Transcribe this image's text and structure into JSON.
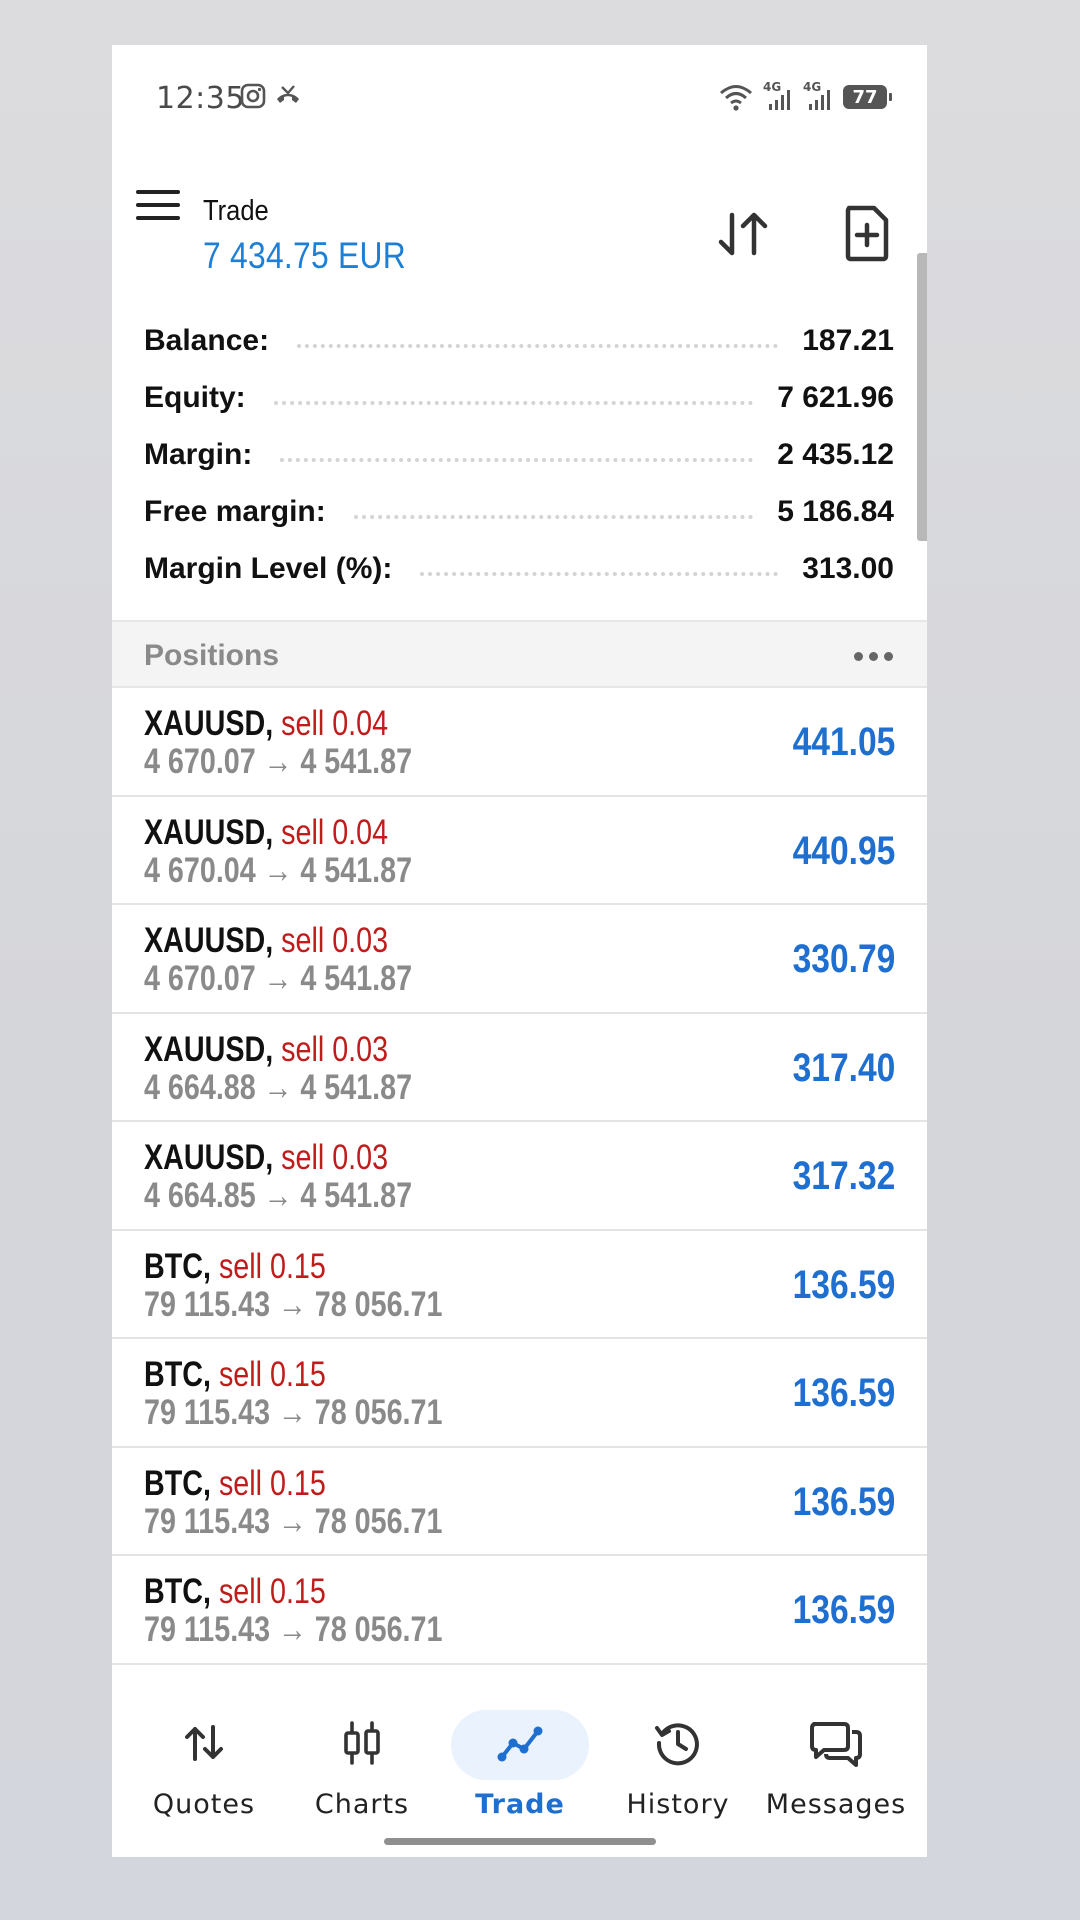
{
  "status_bar": {
    "time": "12:35",
    "net1": "4G",
    "net2": "4G",
    "battery": "77"
  },
  "header": {
    "title": "Trade",
    "subtitle": "7 434.75 EUR"
  },
  "summary": [
    {
      "label": "Balance:",
      "value": "187.21"
    },
    {
      "label": "Equity:",
      "value": "7 621.96"
    },
    {
      "label": "Margin:",
      "value": "2 435.12"
    },
    {
      "label": "Free margin:",
      "value": "5 186.84"
    },
    {
      "label": "Margin Level (%):",
      "value": "313.00"
    }
  ],
  "positions": {
    "label": "Positions",
    "items": [
      {
        "symbol": "XAUUSD,",
        "side": "sell 0.04",
        "prices": "4 670.07 → 4 541.87",
        "profit": "441.05"
      },
      {
        "symbol": "XAUUSD,",
        "side": "sell 0.04",
        "prices": "4 670.04 → 4 541.87",
        "profit": "440.95"
      },
      {
        "symbol": "XAUUSD,",
        "side": "sell 0.03",
        "prices": "4 670.07 → 4 541.87",
        "profit": "330.79"
      },
      {
        "symbol": "XAUUSD,",
        "side": "sell 0.03",
        "prices": "4 664.88 → 4 541.87",
        "profit": "317.40"
      },
      {
        "symbol": "XAUUSD,",
        "side": "sell 0.03",
        "prices": "4 664.85 → 4 541.87",
        "profit": "317.32"
      },
      {
        "symbol": "BTC,",
        "side": "sell 0.15",
        "prices": "79 115.43 → 78 056.71",
        "profit": "136.59"
      },
      {
        "symbol": "BTC,",
        "side": "sell 0.15",
        "prices": "79 115.43 → 78 056.71",
        "profit": "136.59"
      },
      {
        "symbol": "BTC,",
        "side": "sell 0.15",
        "prices": "79 115.43 → 78 056.71",
        "profit": "136.59"
      },
      {
        "symbol": "BTC,",
        "side": "sell 0.15",
        "prices": "79 115.43 → 78 056.71",
        "profit": "136.59"
      }
    ]
  },
  "nav": {
    "items": [
      {
        "label": "Quotes",
        "icon": "quotes-icon"
      },
      {
        "label": "Charts",
        "icon": "charts-icon"
      },
      {
        "label": "Trade",
        "icon": "trade-icon",
        "active": true
      },
      {
        "label": "History",
        "icon": "history-icon"
      },
      {
        "label": "Messages",
        "icon": "messages-icon"
      }
    ]
  },
  "colors": {
    "accent": "#1e6fd0",
    "sell": "#c01c1c",
    "muted": "#8a8a8a"
  }
}
